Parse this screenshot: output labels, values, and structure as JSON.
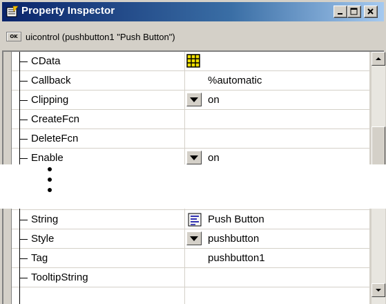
{
  "window": {
    "title": "Property Inspector",
    "object_icon": "OK",
    "object_label": "uicontrol (pushbutton1 \"Push Button\")"
  },
  "top_rows": [
    {
      "name": "CData",
      "value": "",
      "control": "grid-icon"
    },
    {
      "name": "Callback",
      "value": "%automatic",
      "control": "none"
    },
    {
      "name": "Clipping",
      "value": "on",
      "control": "dropdown"
    },
    {
      "name": "CreateFcn",
      "value": "",
      "control": "none"
    },
    {
      "name": "DeleteFcn",
      "value": "",
      "control": "none"
    },
    {
      "name": "Enable",
      "value": "on",
      "control": "dropdown"
    }
  ],
  "bottom_rows": [
    {
      "name": "String",
      "value": "Push Button",
      "control": "text-edit-icon"
    },
    {
      "name": "Style",
      "value": "pushbutton",
      "control": "dropdown"
    },
    {
      "name": "Tag",
      "value": "pushbutton1",
      "control": "none"
    },
    {
      "name": "TooltipString",
      "value": "",
      "control": "none"
    }
  ],
  "colors": {
    "title_gradient_start": "#0a246a",
    "title_gradient_end": "#a6caf0",
    "window_face": "#d4d0c8"
  }
}
